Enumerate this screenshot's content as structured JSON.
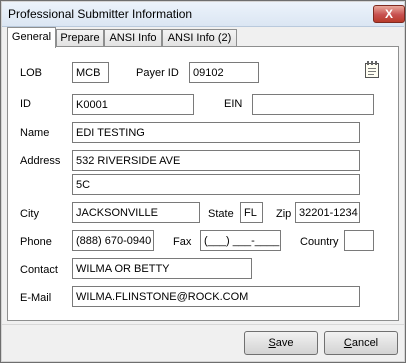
{
  "window": {
    "title": "Professional Submitter Information",
    "close_glyph": "X"
  },
  "tabs": [
    {
      "label": "General",
      "active": true
    },
    {
      "label": "Prepare",
      "active": false
    },
    {
      "label": "ANSI Info",
      "active": false
    },
    {
      "label": "ANSI Info (2)",
      "active": false
    }
  ],
  "form": {
    "lob": {
      "label": "LOB",
      "value": "MCB"
    },
    "payer_id": {
      "label": "Payer ID",
      "value": "09102"
    },
    "id": {
      "label": "ID",
      "value": "K0001"
    },
    "ein": {
      "label": "EIN",
      "value": ""
    },
    "name": {
      "label": "Name",
      "value": "EDI TESTING"
    },
    "address": {
      "label": "Address",
      "line1": "532 RIVERSIDE AVE",
      "line2": "5C"
    },
    "city": {
      "label": "City",
      "value": "JACKSONVILLE"
    },
    "state": {
      "label": "State",
      "value": "FL"
    },
    "zip": {
      "label": "Zip",
      "value": "32201-1234"
    },
    "phone": {
      "label": "Phone",
      "value": "(888) 670-0940"
    },
    "fax": {
      "label": "Fax",
      "value": "(___) ___-____"
    },
    "country": {
      "label": "Country",
      "value": ""
    },
    "contact": {
      "label": "Contact",
      "value": "WILMA OR BETTY"
    },
    "email": {
      "label": "E-Mail",
      "value": "WILMA.FLINSTONE@ROCK.COM"
    }
  },
  "icons": {
    "notes": "notepad-icon"
  },
  "buttons": {
    "save": {
      "label_rest": "ave",
      "mnemonic": "S"
    },
    "cancel": {
      "label_rest": "ancel",
      "mnemonic": "C"
    }
  },
  "colors": {
    "close_button": "#c75050",
    "titlebar": "#dbe6f3"
  }
}
